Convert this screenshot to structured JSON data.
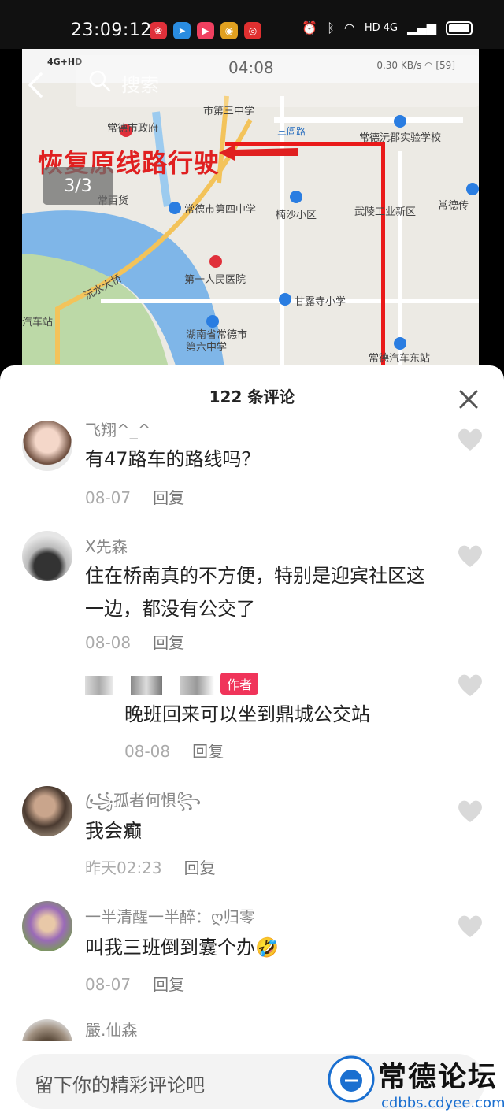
{
  "status_bar": {
    "time": "23:09:12",
    "network": "HD 4G",
    "battery_level": 1.0
  },
  "map_screenshot": {
    "inner_status_time": "04:08",
    "inner_signal": "4G+HD",
    "inner_speed": "0.30 KB/s",
    "inner_battery": "59",
    "annotation": "恢复原线路行驶",
    "labels": {
      "city_gov": "常德市政府",
      "third_middle": "市第三中学",
      "sanlu_road": "三闾路",
      "experimental_school": "常德沅郡实验学校",
      "department_store": "常百货",
      "fourth_middle": "常德市第四中学",
      "nansha": "楠沙小区",
      "industrial": "武陵工业新区",
      "media": "常德传",
      "yuanshui_bridge": "沅水大桥",
      "first_hospital": "第一人民医院",
      "ganlu_school": "甘露寺小学",
      "sixth_middle": "湖南省常德市第六中学",
      "east_bus_station": "常德汽车东站",
      "bus_station": "汽车站"
    }
  },
  "search": {
    "placeholder": "搜索"
  },
  "pager": "3/3",
  "comments_sheet": {
    "title": "122 条评论",
    "reply_label": "回复",
    "comments": [
      {
        "name": "飞翔^_^",
        "text": "有47路车的路线吗？",
        "date": "08-07"
      },
      {
        "name": "X先森",
        "text": "住在桥南真的不方便，特别是迎宾社区这一边，都没有公交了",
        "date": "08-08"
      },
      {
        "badge": "作者",
        "text": "晚班回来可以坐到鼎城公交站",
        "date": "08-08"
      },
      {
        "name": "꧁ꦿ孤者何惧꧂",
        "text": "我会癫",
        "date": "昨天02:23"
      },
      {
        "name": "一半清醒一半醉：ღ归零",
        "text": "叫我三班倒到囊个办🤣",
        "date": "08-07"
      },
      {
        "name": "嚴.仙森"
      }
    ]
  },
  "input": {
    "placeholder": "留下你的精彩评论吧"
  },
  "watermark": {
    "name": "常德论坛",
    "url": "cdbbs.cdyee.com"
  }
}
